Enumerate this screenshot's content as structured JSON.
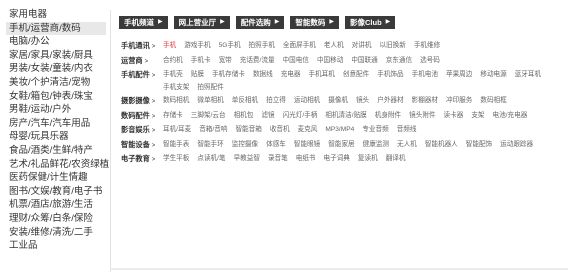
{
  "sidebar": {
    "items": [
      {
        "label": "家用电器",
        "active": false
      },
      {
        "label": "手机/运营商/数码",
        "active": true
      },
      {
        "label": "电脑/办公",
        "active": false
      },
      {
        "label": "家居/家具/家装/厨具",
        "active": false
      },
      {
        "label": "男装/女装/童装/内衣",
        "active": false
      },
      {
        "label": "美妆/个护清洁/宠物",
        "active": false
      },
      {
        "label": "女鞋/箱包/钟表/珠宝",
        "active": false
      },
      {
        "label": "男鞋/运动/户外",
        "active": false
      },
      {
        "label": "房产/汽车/汽车用品",
        "active": false
      },
      {
        "label": "母婴/玩具乐器",
        "active": false
      },
      {
        "label": "食品/酒类/生鲜/特产",
        "active": false
      },
      {
        "label": "艺术/礼品鲜花/农资绿植",
        "active": false
      },
      {
        "label": "医药保健/计生情趣",
        "active": false
      },
      {
        "label": "图书/文娱/教育/电子书",
        "active": false
      },
      {
        "label": "机票/酒店/旅游/生活",
        "active": false
      },
      {
        "label": "理财/众筹/白条/保险",
        "active": false
      },
      {
        "label": "安装/维修/清洗/二手",
        "active": false
      },
      {
        "label": "工业品",
        "active": false
      }
    ]
  },
  "chips": [
    {
      "label": "手机频道"
    },
    {
      "label": "网上营业厅"
    },
    {
      "label": "配件选购"
    },
    {
      "label": "智能数码"
    },
    {
      "label": "影像Club"
    }
  ],
  "rows": [
    {
      "label": "手机通讯",
      "items": [
        {
          "text": "手机",
          "highlight": true
        },
        {
          "text": "游戏手机"
        },
        {
          "text": "5G手机"
        },
        {
          "text": "拍照手机"
        },
        {
          "text": "全面屏手机"
        },
        {
          "text": "老人机"
        },
        {
          "text": "对讲机"
        },
        {
          "text": "以旧换新"
        },
        {
          "text": "手机维修"
        }
      ]
    },
    {
      "label": "运营商",
      "items": [
        {
          "text": "合约机"
        },
        {
          "text": "手机卡"
        },
        {
          "text": "宽带"
        },
        {
          "text": "充话费/流量"
        },
        {
          "text": "中国电信"
        },
        {
          "text": "中国移动"
        },
        {
          "text": "中国联通"
        },
        {
          "text": "京东通信"
        },
        {
          "text": "选号码"
        }
      ]
    },
    {
      "label": "手机配件",
      "items": [
        {
          "text": "手机壳"
        },
        {
          "text": "贴膜"
        },
        {
          "text": "手机存储卡"
        },
        {
          "text": "数据线"
        },
        {
          "text": "充电器"
        },
        {
          "text": "手机耳机"
        },
        {
          "text": "创意配件"
        },
        {
          "text": "手机饰品"
        },
        {
          "text": "手机电池"
        },
        {
          "text": "苹果周边"
        },
        {
          "text": "移动电源"
        },
        {
          "text": "蓝牙耳机"
        },
        {
          "text": "手机支架"
        },
        {
          "text": "拍照配件"
        }
      ]
    },
    {
      "label": "摄影摄像",
      "items": [
        {
          "text": "数码相机"
        },
        {
          "text": "微单相机"
        },
        {
          "text": "单反相机"
        },
        {
          "text": "拍立得"
        },
        {
          "text": "运动相机"
        },
        {
          "text": "摄像机"
        },
        {
          "text": "镜头"
        },
        {
          "text": "户外器材"
        },
        {
          "text": "影棚器材"
        },
        {
          "text": "冲印服务"
        },
        {
          "text": "数码相框"
        }
      ]
    },
    {
      "label": "数码配件",
      "items": [
        {
          "text": "存储卡"
        },
        {
          "text": "三脚架/云台"
        },
        {
          "text": "相机包"
        },
        {
          "text": "滤镜"
        },
        {
          "text": "闪光灯/手柄"
        },
        {
          "text": "相机清洁/贴膜"
        },
        {
          "text": "机身附件"
        },
        {
          "text": "镜头附件"
        },
        {
          "text": "读卡器"
        },
        {
          "text": "支架"
        },
        {
          "text": "电池/充电器"
        }
      ]
    },
    {
      "label": "影音娱乐",
      "items": [
        {
          "text": "耳机/耳麦"
        },
        {
          "text": "音箱/音响"
        },
        {
          "text": "智能音箱"
        },
        {
          "text": "收音机"
        },
        {
          "text": "麦克风"
        },
        {
          "text": "MP3/MP4"
        },
        {
          "text": "专业音频"
        },
        {
          "text": "音频线"
        }
      ]
    },
    {
      "label": "智能设备",
      "items": [
        {
          "text": "智能手表"
        },
        {
          "text": "智能手环"
        },
        {
          "text": "监控摄像"
        },
        {
          "text": "体感车"
        },
        {
          "text": "智能眼镜"
        },
        {
          "text": "智能家居"
        },
        {
          "text": "健康监测"
        },
        {
          "text": "无人机"
        },
        {
          "text": "智能机器人"
        },
        {
          "text": "智能配饰"
        },
        {
          "text": "运动跟踪器"
        }
      ]
    },
    {
      "label": "电子教育",
      "items": [
        {
          "text": "学生平板"
        },
        {
          "text": "点读机/笔"
        },
        {
          "text": "早教益智"
        },
        {
          "text": "录音笔"
        },
        {
          "text": "电纸书"
        },
        {
          "text": "电子词典"
        },
        {
          "text": "复读机"
        },
        {
          "text": "翻译机"
        }
      ]
    }
  ]
}
